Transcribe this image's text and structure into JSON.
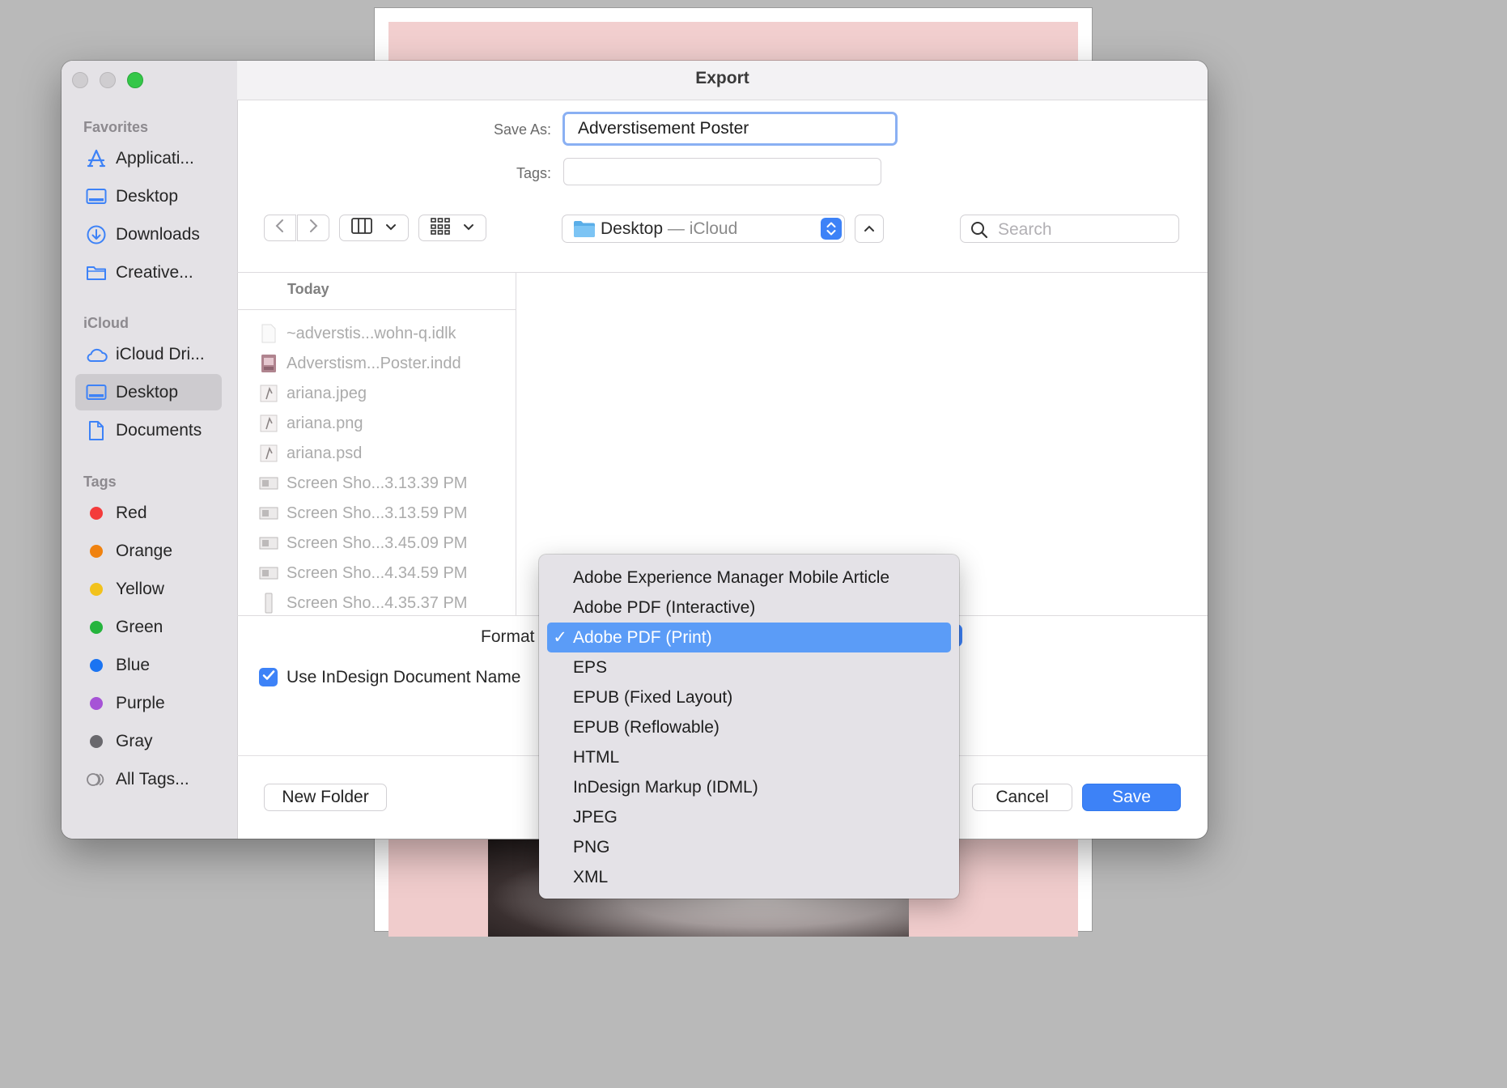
{
  "window": {
    "title": "Export"
  },
  "sidebar": {
    "favorites_header": "Favorites",
    "favorites": [
      {
        "label": "Applicati...",
        "icon": "applications-icon"
      },
      {
        "label": "Desktop",
        "icon": "desktop-icon"
      },
      {
        "label": "Downloads",
        "icon": "downloads-icon"
      },
      {
        "label": "Creative...",
        "icon": "folder-icon"
      }
    ],
    "icloud_header": "iCloud",
    "icloud": [
      {
        "label": "iCloud Dri...",
        "icon": "icloud-icon"
      },
      {
        "label": "Desktop",
        "icon": "desktop-icon",
        "selected": true
      },
      {
        "label": "Documents",
        "icon": "document-icon"
      }
    ],
    "tags_header": "Tags",
    "tags": [
      {
        "label": "Red",
        "color": "#f43b3b"
      },
      {
        "label": "Orange",
        "color": "#f0820f"
      },
      {
        "label": "Yellow",
        "color": "#f2c21c"
      },
      {
        "label": "Green",
        "color": "#25b43d"
      },
      {
        "label": "Blue",
        "color": "#1b74f2"
      },
      {
        "label": "Purple",
        "color": "#a653d6"
      },
      {
        "label": "Gray",
        "color": "#69686d"
      }
    ],
    "all_tags": "All Tags..."
  },
  "form": {
    "save_as_label": "Save As:",
    "save_as_value": "Adverstisement Poster",
    "tags_label": "Tags:",
    "tags_value": ""
  },
  "toolbar": {
    "location_name": "Desktop",
    "location_sep": " — ",
    "location_suffix": "iCloud",
    "search_placeholder": "Search"
  },
  "browser": {
    "column_header": "Today",
    "files": [
      {
        "name": "~adverstis...wohn-q.idlk",
        "icon": "blank-file-icon"
      },
      {
        "name": "Adverstism...Poster.indd",
        "icon": "indesign-file-icon"
      },
      {
        "name": "ariana.jpeg",
        "icon": "image-file-icon"
      },
      {
        "name": "ariana.png",
        "icon": "image-file-icon"
      },
      {
        "name": "ariana.psd",
        "icon": "image-file-icon"
      },
      {
        "name": "Screen Sho...3.13.39 PM",
        "icon": "screenshot-file-icon"
      },
      {
        "name": "Screen Sho...3.13.59 PM",
        "icon": "screenshot-file-icon"
      },
      {
        "name": "Screen Sho...3.45.09 PM",
        "icon": "screenshot-file-icon"
      },
      {
        "name": "Screen Sho...4.34.59 PM",
        "icon": "screenshot-file-icon"
      },
      {
        "name": "Screen Sho...4.35.37 PM",
        "icon": "screenshot-file-icon"
      }
    ]
  },
  "options": {
    "format_label": "Format",
    "use_doc_name_label": "Use InDesign Document Name",
    "use_doc_name_checked": true
  },
  "format_menu": {
    "items": [
      "Adobe Experience Manager Mobile Article",
      "Adobe PDF (Interactive)",
      "Adobe PDF (Print)",
      "EPS",
      "EPUB (Fixed Layout)",
      "EPUB (Reflowable)",
      "HTML",
      "InDesign Markup (IDML)",
      "JPEG",
      "PNG",
      "XML"
    ],
    "selected": "Adobe PDF (Print)",
    "check_mark": "✓"
  },
  "buttons": {
    "new_folder": "New Folder",
    "cancel": "Cancel",
    "save": "Save"
  },
  "colors": {
    "accent": "#3d82f7",
    "menu_highlight": "#5b9cf7"
  }
}
